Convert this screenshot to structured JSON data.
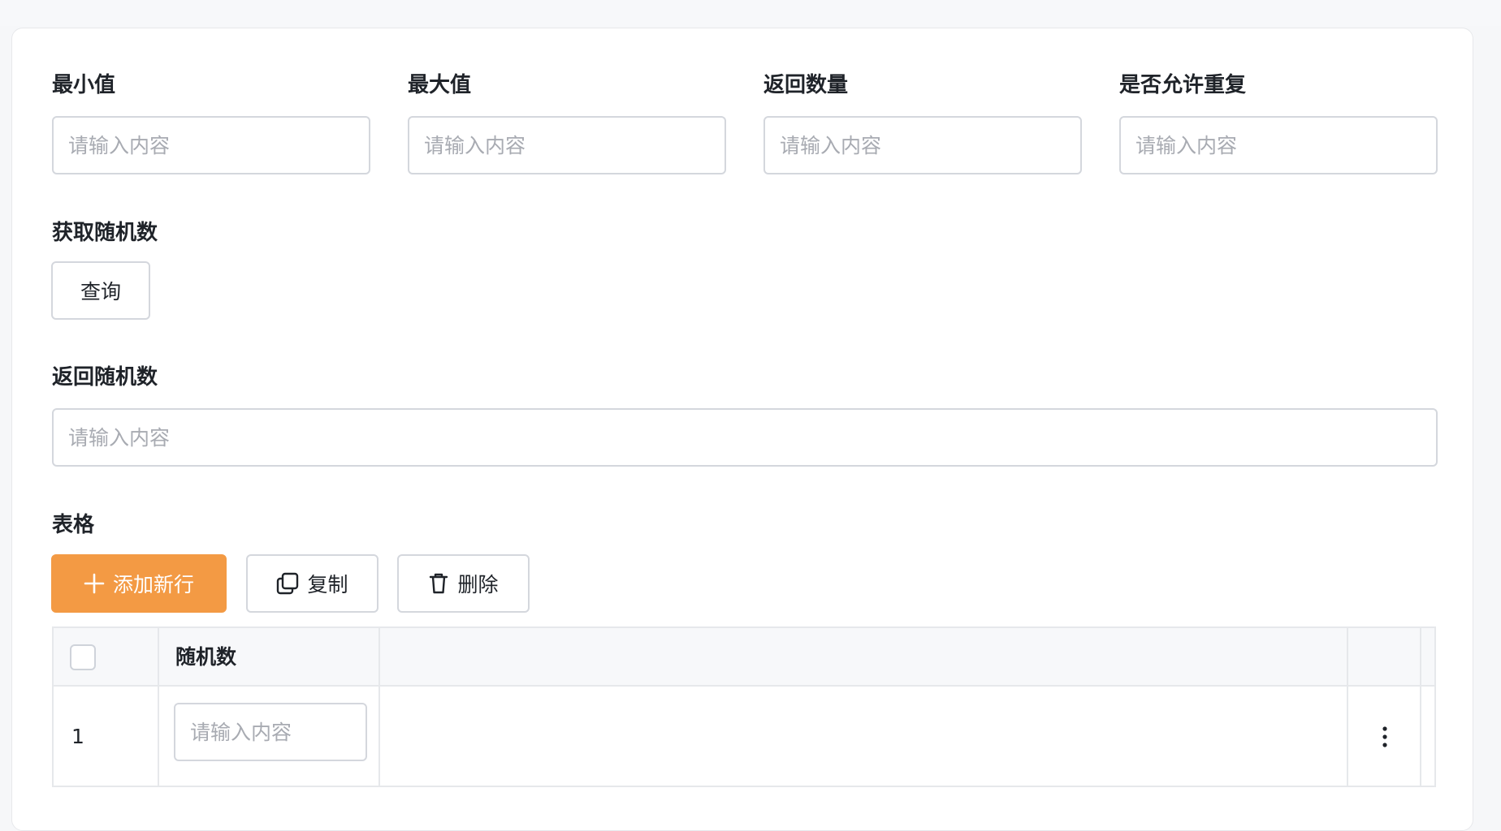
{
  "form": {
    "min_label": "最小值",
    "max_label": "最大值",
    "count_label": "返回数量",
    "repeat_label": "是否允许重复",
    "placeholder": "请输入内容",
    "fetch_label": "获取随机数",
    "query_button": "查询",
    "result_label": "返回随机数"
  },
  "table_section": {
    "label": "表格",
    "add_button": "添加新行",
    "copy_button": "复制",
    "delete_button": "删除",
    "column_header": "随机数",
    "rows": [
      {
        "index": "1",
        "placeholder": "请输入内容"
      }
    ]
  },
  "colors": {
    "primary": "#f39a44",
    "border": "#d4d7dd",
    "placeholder": "#a8abb2"
  },
  "icons": {
    "add": "plus-icon",
    "copy": "copy-icon",
    "delete": "trash-icon",
    "row_actions": "more-vertical-icon"
  }
}
